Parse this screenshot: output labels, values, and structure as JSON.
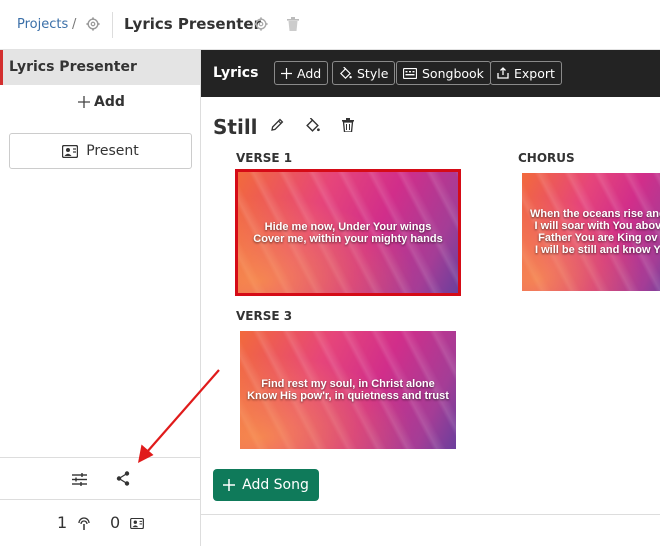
{
  "breadcrumb": {
    "projects_label": "Projects",
    "separator": "/"
  },
  "project": {
    "title": "Lyrics Presenter"
  },
  "sidebar": {
    "header": "Lyrics Presenter",
    "add_label": "Add",
    "present_label": "Present",
    "stats": {
      "remote_count": "1",
      "display_count": "0"
    }
  },
  "main": {
    "section_title": "Lyrics",
    "toolbar": {
      "add_label": "Add",
      "style_label": "Style",
      "songbook_label": "Songbook",
      "export_label": "Export"
    },
    "song": {
      "title": "Still",
      "slides": [
        {
          "label": "VERSE 1",
          "lyrics": "Hide me now, Under Your wings\nCover me, within your mighty hands",
          "selected": true
        },
        {
          "label": "CHORUS",
          "lyrics": "When the oceans rise and\nI will soar with You abov\nFather You are King ov\nI will be still and know Y",
          "selected": false
        },
        {
          "label": "VERSE 3",
          "lyrics": "Find rest my soul, in Christ alone\nKnow His pow'r, in quietness and trust",
          "selected": false
        }
      ]
    },
    "add_song_label": "Add Song"
  },
  "colors": {
    "accent_red": "#d32f2f",
    "selection_red": "#d50b17",
    "add_song_green": "#0f7a5a",
    "dark_bar": "#232323",
    "link_blue": "#3a6fa8"
  },
  "icons": [
    "gear-icon",
    "trash-icon",
    "plus-icon",
    "present-icon",
    "plus-square-icon",
    "paint-bucket-icon",
    "songbook-icon",
    "export-icon",
    "pencil-icon",
    "sliders-icon",
    "share-icon",
    "remote-icon"
  ]
}
